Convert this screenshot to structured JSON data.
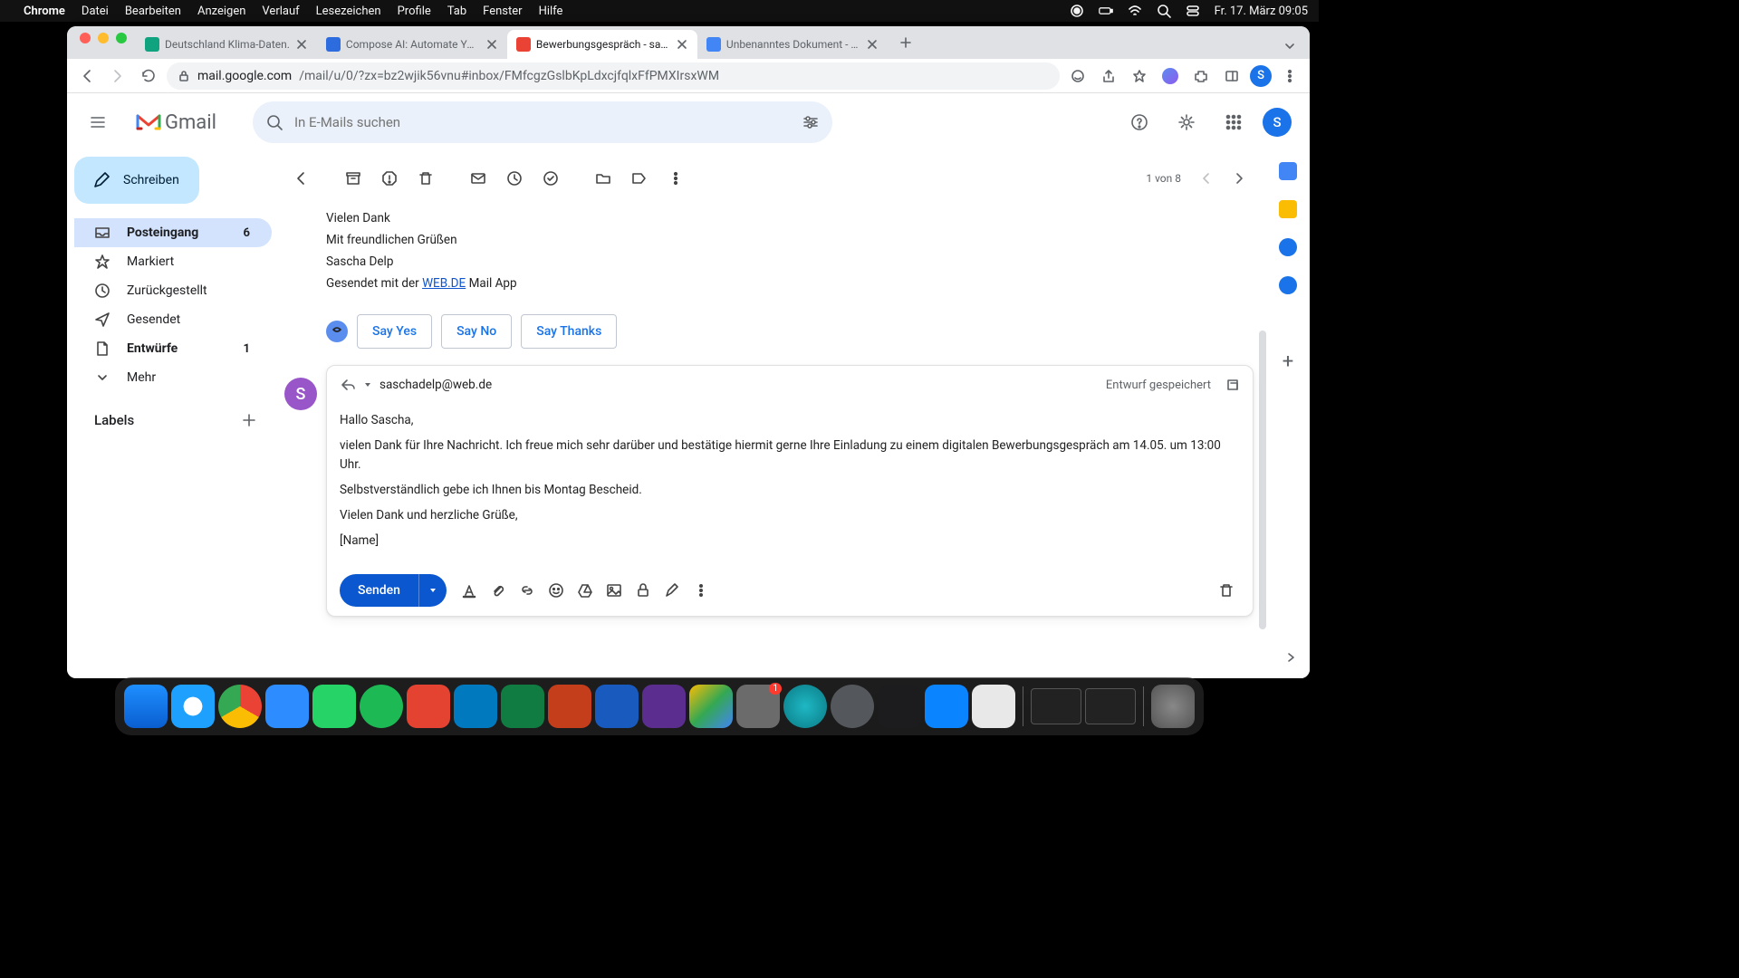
{
  "macmenu": {
    "app": "Chrome",
    "items": [
      "Datei",
      "Bearbeiten",
      "Anzeigen",
      "Verlauf",
      "Lesezeichen",
      "Profile",
      "Tab",
      "Fenster",
      "Hilfe"
    ],
    "clock": "Fr. 17. März 09:05"
  },
  "tabs": [
    {
      "title": "Deutschland Klima-Daten.",
      "favicon": "#10a37f"
    },
    {
      "title": "Compose AI: Automate Your W",
      "favicon": "#2d6cdf"
    },
    {
      "title": "Bewerbungsgespräch - sascha",
      "favicon": "#ea4335",
      "active": true
    },
    {
      "title": "Unbenanntes Dokument - Goo",
      "favicon": "#4285f4"
    }
  ],
  "url": {
    "host": "mail.google.com",
    "path": "/mail/u/0/?zx=bz2wjik56vnu#inbox/FMfcgzGslbKpLdxcjfqlxFfPMXIrsxWM"
  },
  "gmail": {
    "logo": "Gmail",
    "search_placeholder": "In E-Mails suchen",
    "avatar_initial": "S",
    "compose": "Schreiben",
    "nav": [
      {
        "icon": "inbox",
        "label": "Posteingang",
        "count": "6",
        "active": true,
        "bold": true
      },
      {
        "icon": "star",
        "label": "Markiert"
      },
      {
        "icon": "clock",
        "label": "Zurückgestellt"
      },
      {
        "icon": "send",
        "label": "Gesendet"
      },
      {
        "icon": "draft",
        "label": "Entwürfe",
        "count": "1",
        "bold": true
      },
      {
        "icon": "more",
        "label": "Mehr"
      }
    ],
    "labels_header": "Labels",
    "pagecount": "1 von 8",
    "prev_body": {
      "l1": "Vielen Dank",
      "l2": "Mit freundlichen Grüßen",
      "l3": "Sascha Delp",
      "l4_pre": "Gesendet mit der ",
      "l4_link": "WEB.DE",
      "l4_post": " Mail App"
    },
    "suggestions": [
      "Say Yes",
      "Say No",
      "Say Thanks"
    ],
    "reply": {
      "avatar_initial": "S",
      "to": "saschadelp@web.de",
      "draft_saved": "Entwurf gespeichert",
      "body": {
        "p1": "Hallo Sascha,",
        "p2": "vielen Dank für Ihre Nachricht. Ich freue mich sehr darüber und bestätige hiermit gerne Ihre Einladung zu einem digitalen Bewerbungsgespräch am 14.05. um 13:00 Uhr.",
        "p3": "Selbstverständlich gebe ich Ihnen bis Montag Bescheid.",
        "p4": "Vielen Dank und herzliche Grüße,",
        "p5": "[Name]"
      },
      "send": "Senden"
    }
  },
  "dock_apps": [
    {
      "name": "finder",
      "bg": "#1e8fff"
    },
    {
      "name": "safari",
      "bg": "#1ea0ff"
    },
    {
      "name": "chrome",
      "bg": "#f1f1f1"
    },
    {
      "name": "zoom",
      "bg": "#2d8cff"
    },
    {
      "name": "whatsapp",
      "bg": "#25d366"
    },
    {
      "name": "spotify",
      "bg": "#1db954"
    },
    {
      "name": "todoist",
      "bg": "#e44332"
    },
    {
      "name": "trello",
      "bg": "#0079bf"
    },
    {
      "name": "excel",
      "bg": "#107c41"
    },
    {
      "name": "powerpoint",
      "bg": "#c43e1c"
    },
    {
      "name": "word",
      "bg": "#185abd"
    },
    {
      "name": "imovie",
      "bg": "#5b2d8f"
    },
    {
      "name": "drive",
      "bg": "#ffffff"
    },
    {
      "name": "settings",
      "bg": "#6b6b6b",
      "badge": "1"
    },
    {
      "name": "siri",
      "bg": "#1eb8c4"
    },
    {
      "name": "quicktime",
      "bg": "#54575c"
    },
    {
      "name": "voice-memos",
      "bg": "#1c1c1e"
    },
    {
      "name": "app-store",
      "bg": "#0a84ff"
    },
    {
      "name": "app",
      "bg": "#e8e8e8"
    }
  ]
}
